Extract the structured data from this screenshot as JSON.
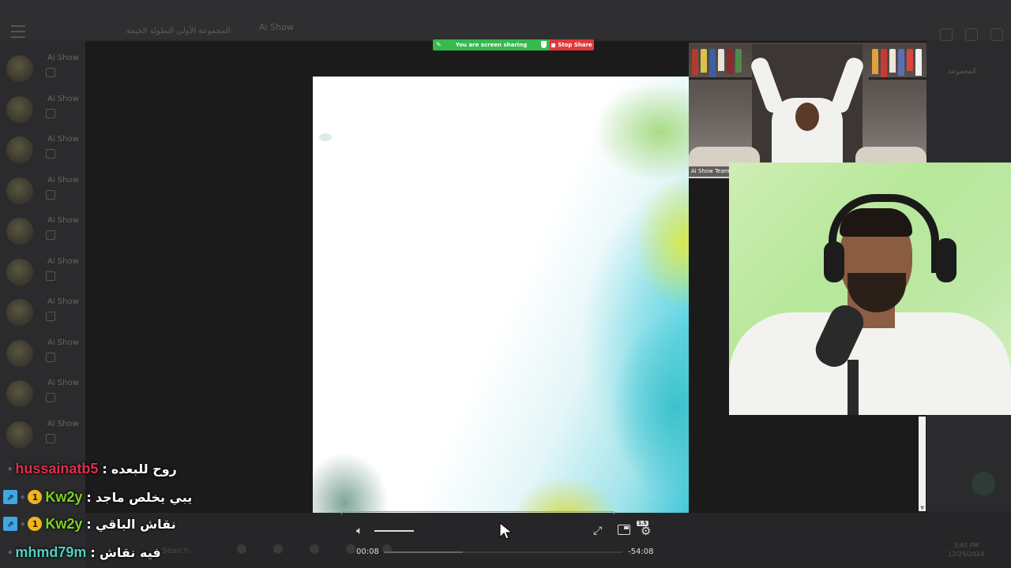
{
  "background_app": {
    "title": "Ai Show",
    "breadcrumb": "المجموعة الأولى البطولة الخيمة",
    "right_text": "المجموعة",
    "sidebar_items": [
      "Ai Show",
      "Ai Show",
      "Ai Show",
      "Ai Show",
      "Ai Show",
      "Ai Show",
      "Ai Show",
      "Ai Show",
      "Ai Show",
      "Ai Show"
    ],
    "taskbar_search": "Search",
    "clock": "3:40 PM\n12/25/2024"
  },
  "screen_share": {
    "status_text": "You are screen sharing",
    "stop_label": "Stop Share",
    "status_color": "#36b94d",
    "stop_color": "#e03a3a"
  },
  "zoom_cam": {
    "name": "Ai Show Team"
  },
  "chat": [
    {
      "user": "hussainatb5",
      "user_color": "#e0304a",
      "text": "روح للبعده",
      "prime": false,
      "gold": false
    },
    {
      "user": "Kw2y",
      "user_color": "#7ed321",
      "text": "يبي يخلص ماجد",
      "prime": true,
      "gold": true,
      "gold_num": "1"
    },
    {
      "user": "Kw2y",
      "user_color": "#7ed321",
      "text": "نقاش الباقي",
      "prime": true,
      "gold": true,
      "gold_num": "1"
    },
    {
      "user": "mhmd79m",
      "user_color": "#4fd0c0",
      "text": "فيه نقاش",
      "prime": false,
      "gold": false
    }
  ],
  "player": {
    "current_time": "00:08",
    "remaining_time": "-54:08",
    "volume_fraction": 1.0,
    "progress_fraction": 0.003,
    "buffered_fraction": 0.33,
    "quality_badge": "1.5"
  }
}
